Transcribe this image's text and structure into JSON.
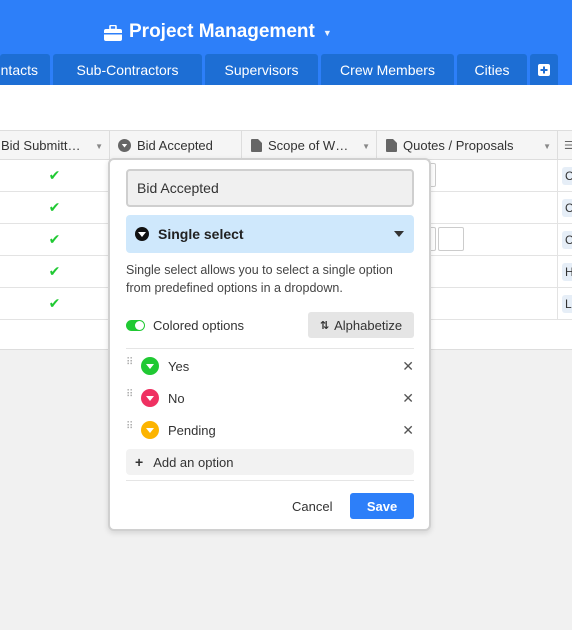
{
  "app": {
    "title": "Project Management"
  },
  "tabs": [
    "ntacts",
    "Sub-Contractors",
    "Supervisors",
    "Crew Members",
    "Cities"
  ],
  "columns": [
    "Bid Submitt…",
    "Bid Accepted",
    "Scope of W…",
    "Quotes / Proposals"
  ],
  "rows": [
    {
      "bid_submitted": "✔",
      "city_tag": "C"
    },
    {
      "bid_submitted": "✔",
      "city_tag": "C"
    },
    {
      "bid_submitted": "✔",
      "city_tag": "C"
    },
    {
      "bid_submitted": "✔",
      "city_tag": "H"
    },
    {
      "bid_submitted": "✔",
      "city_tag": "L"
    }
  ],
  "dialog": {
    "field_name": "Bid Accepted",
    "field_type": "Single select",
    "description": "Single select allows you to select a single option from predefined options in a dropdown.",
    "colored_options_label": "Colored options",
    "alphabetize_label": "Alphabetize",
    "options": [
      {
        "label": "Yes",
        "color": "#20c933"
      },
      {
        "label": "No",
        "color": "#ef3061"
      },
      {
        "label": "Pending",
        "color": "#fcb400"
      }
    ],
    "add_option_label": "Add an option",
    "cancel_label": "Cancel",
    "save_label": "Save"
  },
  "colors": {
    "brand": "#2d7ff9",
    "tab": "#1d6ed4",
    "type_select_bg": "#cfe8fc"
  }
}
